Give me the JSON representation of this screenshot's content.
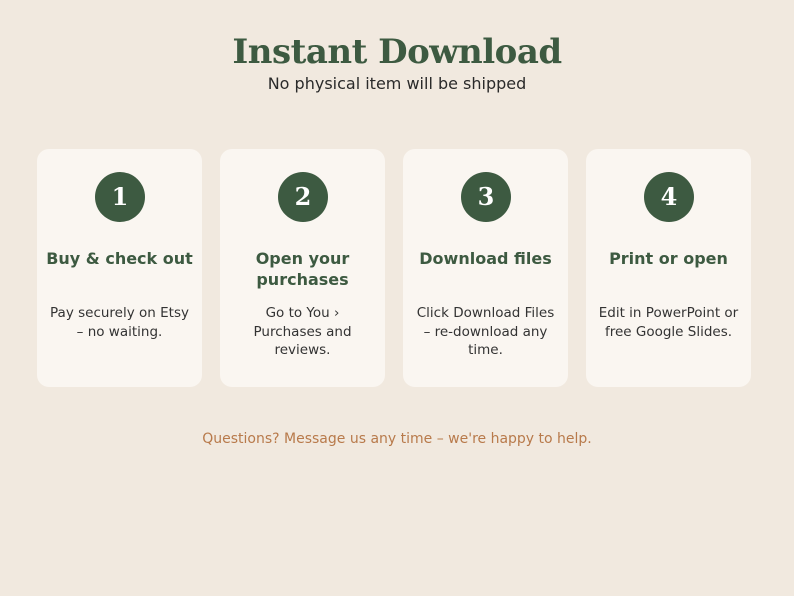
{
  "header": {
    "title": "Instant Download",
    "subtitle": "No physical item will be shipped"
  },
  "steps": [
    {
      "number": "1",
      "title": "Buy & check out",
      "description": "Pay securely on Etsy – no waiting."
    },
    {
      "number": "2",
      "title": "Open your purchases",
      "description": "Go to You › Purchases and reviews."
    },
    {
      "number": "3",
      "title": "Download files",
      "description": "Click Download Files – re-download any time."
    },
    {
      "number": "4",
      "title": "Print or open",
      "description": "Edit in PowerPoint or free Google Slides."
    }
  ],
  "footer": {
    "note": "Questions? Message us any time – we're happy to help."
  },
  "colors": {
    "background": "#f1e9df",
    "card": "#faf6f1",
    "accent_green": "#3d5a41",
    "footer_text": "#b87a4b"
  }
}
